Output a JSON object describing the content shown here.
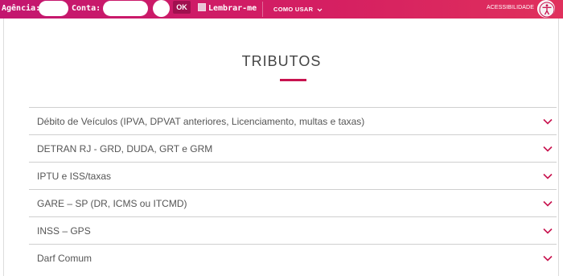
{
  "topbar": {
    "agencia_label": "Agência:",
    "conta_label": "Conta:",
    "ok_label": "OK",
    "lembrar_label": "Lembrar-me",
    "como_usar_label": "COMO USAR",
    "acessibilidade_label": "ACESSIBILIDADE",
    "colors": {
      "bar": "#c3166f",
      "ok_button": "#a0104f"
    }
  },
  "main": {
    "title": "TRIBUTOS",
    "accent_color": "#c8134f",
    "items": [
      {
        "label": "Débito de Veículos (IPVA, DPVAT anteriores, Licenciamento, multas e taxas)"
      },
      {
        "label": "DETRAN RJ - GRD, DUDA, GRT e GRM"
      },
      {
        "label": "IPTU e ISS/taxas"
      },
      {
        "label": "GARE – SP (DR, ICMS ou ITCMD)"
      },
      {
        "label": "INSS – GPS"
      },
      {
        "label": "Darf Comum"
      }
    ],
    "icons": {
      "expand": "chevron-down-icon",
      "accessibility": "accessibility-person-icon"
    }
  }
}
